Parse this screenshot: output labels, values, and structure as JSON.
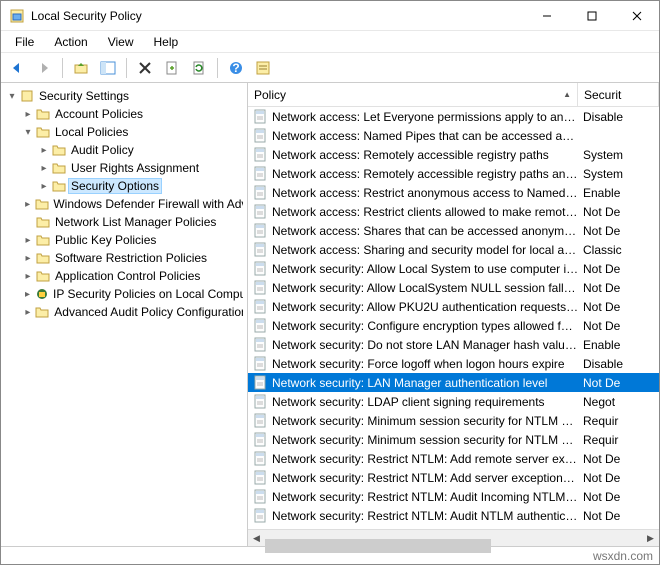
{
  "window": {
    "title": "Local Security Policy"
  },
  "menu": {
    "file": "File",
    "action": "Action",
    "view": "View",
    "help": "Help"
  },
  "tree": {
    "root": "Security Settings",
    "items": [
      {
        "label": "Account Policies",
        "depth": 2,
        "children": true,
        "expanded": false,
        "icon": "folder"
      },
      {
        "label": "Local Policies",
        "depth": 2,
        "children": true,
        "expanded": true,
        "icon": "folder"
      },
      {
        "label": "Audit Policy",
        "depth": 3,
        "children": true,
        "expanded": false,
        "icon": "folder"
      },
      {
        "label": "User Rights Assignment",
        "depth": 3,
        "children": true,
        "expanded": false,
        "icon": "folder"
      },
      {
        "label": "Security Options",
        "depth": 3,
        "children": true,
        "expanded": false,
        "icon": "folder",
        "selected": true
      },
      {
        "label": "Windows Defender Firewall with Adva",
        "depth": 2,
        "children": true,
        "expanded": false,
        "icon": "folder"
      },
      {
        "label": "Network List Manager Policies",
        "depth": 2,
        "children": false,
        "icon": "folder"
      },
      {
        "label": "Public Key Policies",
        "depth": 2,
        "children": true,
        "expanded": false,
        "icon": "folder"
      },
      {
        "label": "Software Restriction Policies",
        "depth": 2,
        "children": true,
        "expanded": false,
        "icon": "folder"
      },
      {
        "label": "Application Control Policies",
        "depth": 2,
        "children": true,
        "expanded": false,
        "icon": "folder"
      },
      {
        "label": "IP Security Policies on Local Compute",
        "depth": 2,
        "children": true,
        "expanded": false,
        "icon": "ipsec"
      },
      {
        "label": "Advanced Audit Policy Configuration",
        "depth": 2,
        "children": true,
        "expanded": false,
        "icon": "folder"
      }
    ]
  },
  "columns": {
    "policy": "Policy",
    "security": "Securit"
  },
  "policies": [
    {
      "name": "Network access: Let Everyone permissions apply to anonym...",
      "setting": "Disable"
    },
    {
      "name": "Network access: Named Pipes that can be accessed anonym...",
      "setting": ""
    },
    {
      "name": "Network access: Remotely accessible registry paths",
      "setting": "System"
    },
    {
      "name": "Network access: Remotely accessible registry paths and sub...",
      "setting": "System"
    },
    {
      "name": "Network access: Restrict anonymous access to Named Pipes...",
      "setting": "Enable"
    },
    {
      "name": "Network access: Restrict clients allowed to make remote call...",
      "setting": "Not De"
    },
    {
      "name": "Network access: Shares that can be accessed anonymously",
      "setting": "Not De"
    },
    {
      "name": "Network access: Sharing and security model for local accou...",
      "setting": "Classic"
    },
    {
      "name": "Network security: Allow Local System to use computer ident...",
      "setting": "Not De"
    },
    {
      "name": "Network security: Allow LocalSystem NULL session fallback",
      "setting": "Not De"
    },
    {
      "name": "Network security: Allow PKU2U authentication requests to t...",
      "setting": "Not De"
    },
    {
      "name": "Network security: Configure encryption types allowed for Ke...",
      "setting": "Not De"
    },
    {
      "name": "Network security: Do not store LAN Manager hash value on ...",
      "setting": "Enable"
    },
    {
      "name": "Network security: Force logoff when logon hours expire",
      "setting": "Disable"
    },
    {
      "name": "Network security: LAN Manager authentication level",
      "setting": "Not De",
      "selected": true
    },
    {
      "name": "Network security: LDAP client signing requirements",
      "setting": "Negot"
    },
    {
      "name": "Network security: Minimum session security for NTLM SSP ...",
      "setting": "Requir"
    },
    {
      "name": "Network security: Minimum session security for NTLM SSP ...",
      "setting": "Requir"
    },
    {
      "name": "Network security: Restrict NTLM: Add remote server excepti...",
      "setting": "Not De"
    },
    {
      "name": "Network security: Restrict NTLM: Add server exceptions in t...",
      "setting": "Not De"
    },
    {
      "name": "Network security: Restrict NTLM: Audit Incoming NTLM Traf...",
      "setting": "Not De"
    },
    {
      "name": "Network security: Restrict NTLM: Audit NTLM authentication...",
      "setting": "Not De"
    }
  ],
  "status": "wsxdn.com"
}
